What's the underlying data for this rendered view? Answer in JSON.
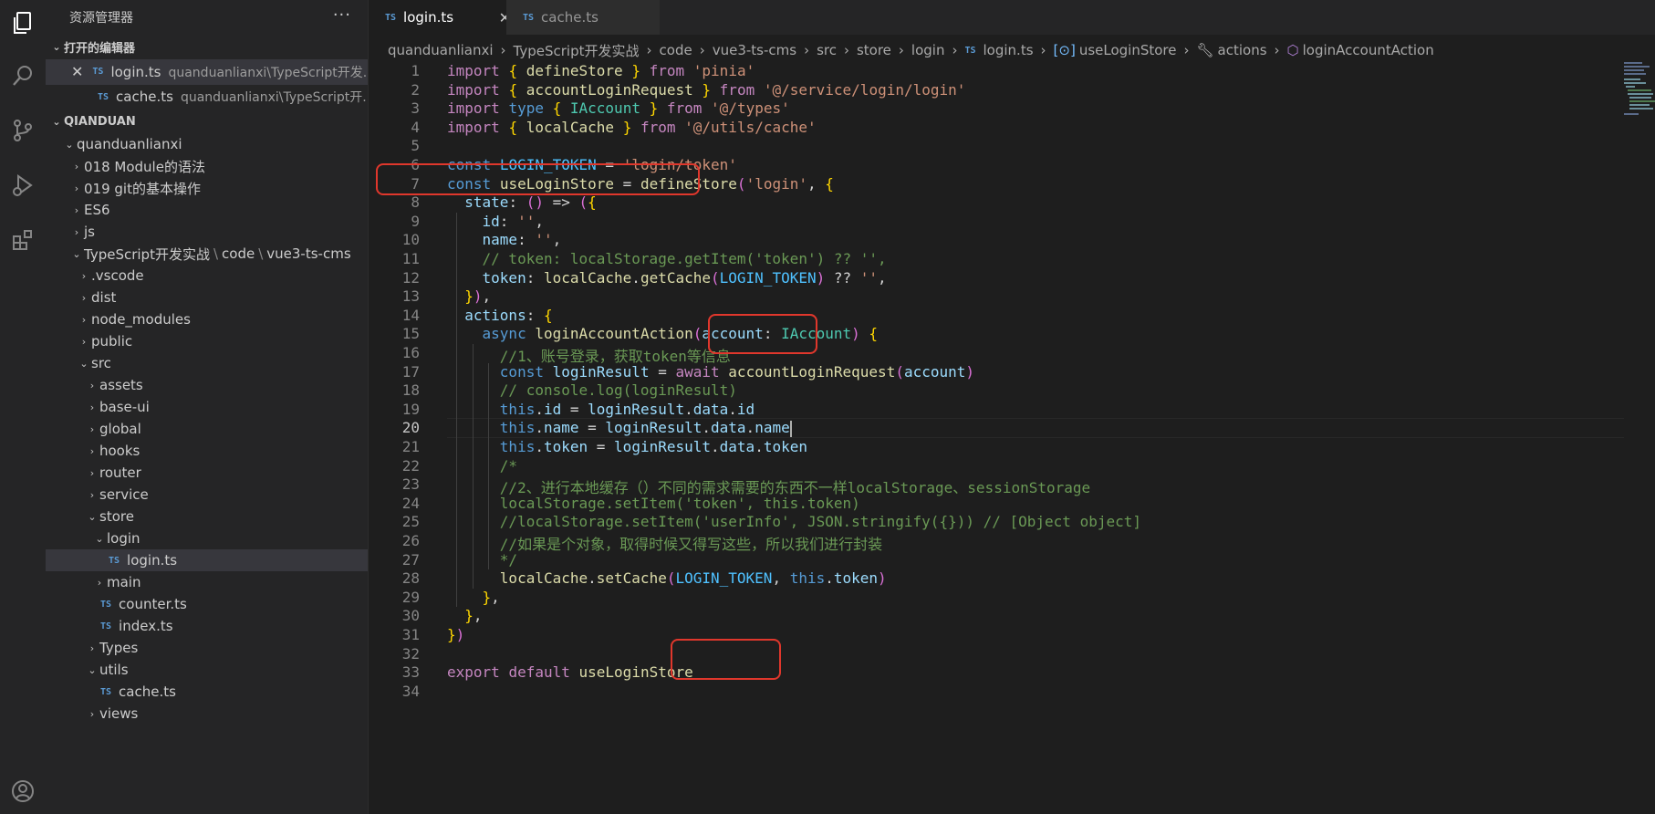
{
  "sidebar": {
    "title": "资源管理器",
    "more": "···",
    "open_editors": {
      "header": "打开的编辑器",
      "items": [
        {
          "icon": "TS",
          "name": "login.ts",
          "path": "quanduanlianxi\\TypeScript开发..."
        },
        {
          "icon": "TS",
          "name": "cache.ts",
          "path": "quanduanlianxi\\TypeScript开..."
        }
      ]
    },
    "workspace_header": "QIANDUAN",
    "tree": [
      {
        "label": "quanduanlianxi"
      },
      {
        "label": "018 Module的语法"
      },
      {
        "label": "019 git的基本操作"
      },
      {
        "label": "ES6"
      },
      {
        "label": "js"
      },
      {
        "label": "TypeScript开发实战",
        "label2": "code",
        "label3": "vue3-ts-cms"
      },
      {
        "label": ".vscode"
      },
      {
        "label": "dist"
      },
      {
        "label": "node_modules"
      },
      {
        "label": "public"
      },
      {
        "label": "src"
      },
      {
        "label": "assets"
      },
      {
        "label": "base-ui"
      },
      {
        "label": "global"
      },
      {
        "label": "hooks"
      },
      {
        "label": "router"
      },
      {
        "label": "service"
      },
      {
        "label": "store"
      },
      {
        "label": "login"
      },
      {
        "label": "login.ts",
        "icon": "TS"
      },
      {
        "label": "main"
      },
      {
        "label": "counter.ts",
        "icon": "TS"
      },
      {
        "label": "index.ts",
        "icon": "TS"
      },
      {
        "label": "Types"
      },
      {
        "label": "utils"
      },
      {
        "label": "cache.ts",
        "icon": "TS"
      },
      {
        "label": "views"
      }
    ]
  },
  "tabs": [
    {
      "icon": "TS",
      "label": "login.ts",
      "close": "✕"
    },
    {
      "icon": "TS",
      "label": "cache.ts"
    }
  ],
  "breadcrumb": {
    "items": [
      "quanduanlianxi",
      "TypeScript开发实战",
      "code",
      "vue3-ts-cms",
      "src",
      "store",
      "login"
    ],
    "file_icon": "TS",
    "file": "login.ts",
    "symbols": [
      "useLoginStore",
      "actions",
      "loginAccountAction"
    ]
  },
  "editor": {
    "current_line": 20,
    "lines": [
      {
        "n": "1",
        "t": "import { defineStore } from 'pinia'"
      },
      {
        "n": "2",
        "t": "import { accountLoginRequest } from '@/service/login/login'"
      },
      {
        "n": "3",
        "t": "import type { IAccount } from '@/types'"
      },
      {
        "n": "4",
        "t": "import { localCache } from '@/utils/cache'"
      },
      {
        "n": "5",
        "t": ""
      },
      {
        "n": "6",
        "t": "const LOGIN_TOKEN = 'login/token'"
      },
      {
        "n": "7",
        "t": "const useLoginStore = defineStore('login', {"
      },
      {
        "n": "8",
        "t": "  state: () => ({"
      },
      {
        "n": "9",
        "t": "    id: '',"
      },
      {
        "n": "10",
        "t": "    name: '',"
      },
      {
        "n": "11",
        "t": "    // token: localStorage.getItem('token') ?? '',"
      },
      {
        "n": "12",
        "t": "    token: localCache.getCache(LOGIN_TOKEN) ?? '',"
      },
      {
        "n": "13",
        "t": "  }),"
      },
      {
        "n": "14",
        "t": "  actions: {"
      },
      {
        "n": "15",
        "t": "    async loginAccountAction(account: IAccount) {"
      },
      {
        "n": "16",
        "t": "      //1、账号登录，获取token等信息"
      },
      {
        "n": "17",
        "t": "      const loginResult = await accountLoginRequest(account)"
      },
      {
        "n": "18",
        "t": "      // console.log(loginResult)"
      },
      {
        "n": "19",
        "t": "      this.id = loginResult.data.id"
      },
      {
        "n": "20",
        "t": "      this.name = loginResult.data.name"
      },
      {
        "n": "21",
        "t": "      this.token = loginResult.data.token"
      },
      {
        "n": "22",
        "t": "      /*"
      },
      {
        "n": "23",
        "t": "      //2、进行本地缓存（）不同的需求需要的东西不一样localStorage、sessionStorage"
      },
      {
        "n": "24",
        "t": "      localStorage.setItem('token', this.token)"
      },
      {
        "n": "25",
        "t": "      //localStorage.setItem('userInfo', JSON.stringify({})) // [Object object]"
      },
      {
        "n": "26",
        "t": "      //如果是个对象，取得时候又得写这些，所以我们进行封装"
      },
      {
        "n": "27",
        "t": "      */"
      },
      {
        "n": "28",
        "t": "      localCache.setCache(LOGIN_TOKEN, this.token)"
      },
      {
        "n": "29",
        "t": "    },"
      },
      {
        "n": "30",
        "t": "  },"
      },
      {
        "n": "31",
        "t": "})"
      },
      {
        "n": "32",
        "t": ""
      },
      {
        "n": "33",
        "t": "export default useLoginStore"
      },
      {
        "n": "34",
        "t": ""
      }
    ]
  }
}
